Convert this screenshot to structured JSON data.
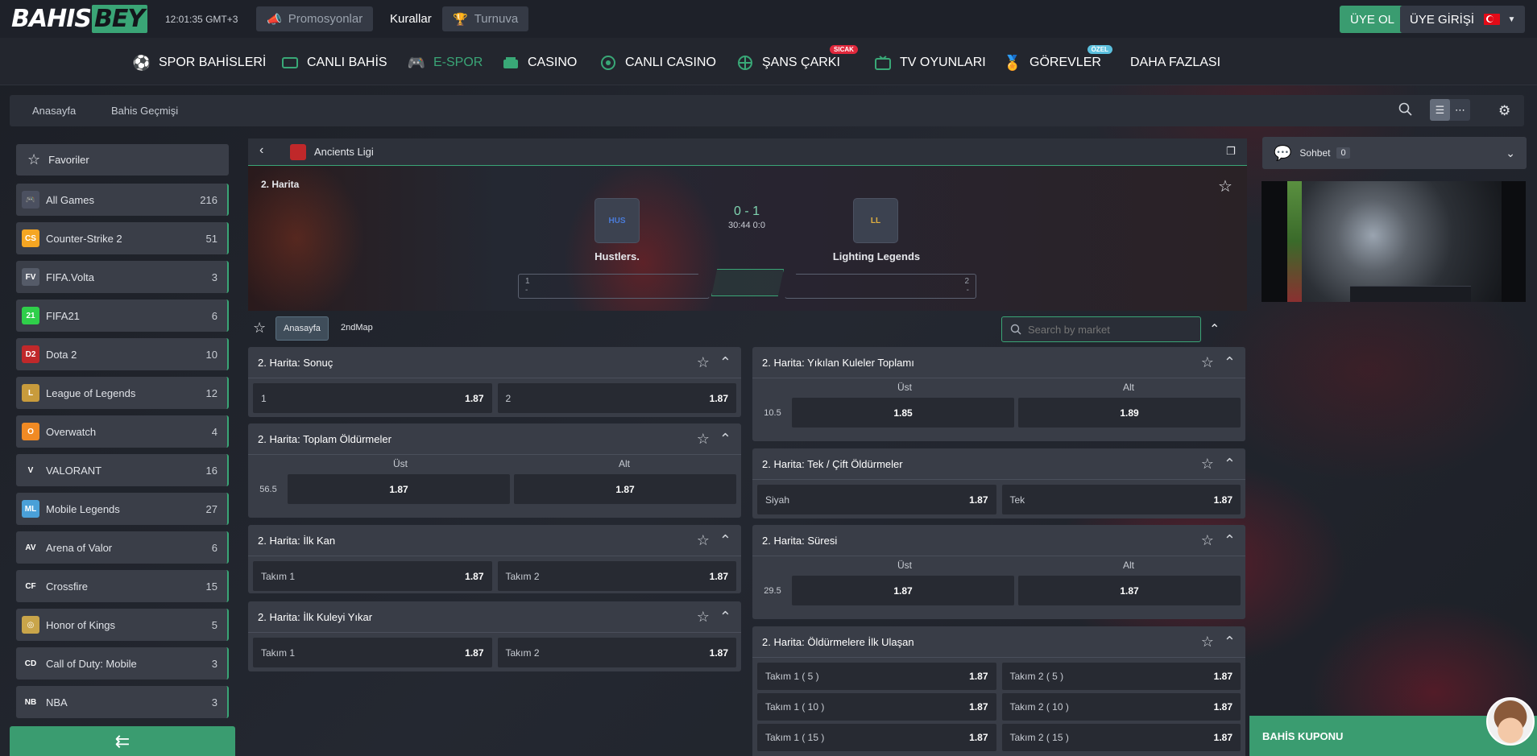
{
  "header": {
    "logo_a": "BAHIS",
    "logo_b": "BEY",
    "clock": "12:01:35",
    "tz": "GMT+3",
    "promo": "Promosyonlar",
    "rules": "Kurallar",
    "tournament": "Turnuva",
    "register": "ÜYE OL",
    "login": "ÜYE GİRİŞİ"
  },
  "nav": {
    "items": [
      {
        "label": "SPOR BAHİSLERİ",
        "icon": "soccer-ball-icon"
      },
      {
        "label": "CANLI BAHİS",
        "icon": "live-icon"
      },
      {
        "label": "E-SPOR",
        "icon": "gamepad-icon"
      },
      {
        "label": "CASINO",
        "icon": "slot-icon"
      },
      {
        "label": "CANLI CASINO",
        "icon": "roulette-icon"
      },
      {
        "label": "ŞANS ÇARKI",
        "icon": "wheel-icon",
        "badge": "SICAK"
      },
      {
        "label": "TV OYUNLARI",
        "icon": "tv-icon"
      },
      {
        "label": "GÖREVLER",
        "icon": "trophy-icon",
        "badge": "ÖZEL"
      },
      {
        "label": "DAHA FAZLASI"
      }
    ],
    "colors": {
      "accent": "#3aa576",
      "hot": "#e0283c",
      "special": "#5bc0de"
    }
  },
  "crumbs": {
    "home": "Anasayfa",
    "history": "Bahis Geçmişi"
  },
  "sidebar": {
    "favorites": "Favoriler",
    "items": [
      {
        "label": "All Games",
        "count": "216",
        "color": "#4b5060",
        "abbr": "🎮"
      },
      {
        "label": "Counter-Strike 2",
        "count": "51",
        "color": "#f5a623",
        "abbr": "CS"
      },
      {
        "label": "FIFA.Volta",
        "count": "3",
        "color": "#555b68",
        "abbr": "FV"
      },
      {
        "label": "FIFA21",
        "count": "6",
        "color": "#2fcf4a",
        "abbr": "21"
      },
      {
        "label": "Dota 2",
        "count": "10",
        "color": "#c0282a",
        "abbr": "D2"
      },
      {
        "label": "League of Legends",
        "count": "12",
        "color": "#c89b3c",
        "abbr": "L"
      },
      {
        "label": "Overwatch",
        "count": "4",
        "color": "#f08a24",
        "abbr": "O"
      },
      {
        "label": "VALORANT",
        "count": "16",
        "color": "#3a3e48",
        "abbr": "V"
      },
      {
        "label": "Mobile Legends",
        "count": "27",
        "color": "#4aa0d8",
        "abbr": "ML"
      },
      {
        "label": "Arena of Valor",
        "count": "6",
        "color": "#3a3e48",
        "abbr": "AV"
      },
      {
        "label": "Crossfire",
        "count": "15",
        "color": "#3a3e48",
        "abbr": "CF"
      },
      {
        "label": "Honor of Kings",
        "count": "5",
        "color": "#c9a54a",
        "abbr": "◎"
      },
      {
        "label": "Call of Duty: Mobile",
        "count": "3",
        "color": "#3a3e48",
        "abbr": "CD"
      },
      {
        "label": "NBA",
        "count": "3",
        "color": "#3a3e48",
        "abbr": "NB"
      }
    ]
  },
  "match": {
    "league": "Ancients Ligi",
    "map": "2. Harita",
    "score": "0 - 1",
    "time": "30:44",
    "sub": "0:0",
    "team1": "Hustlers.",
    "team2": "Lighting Legends",
    "pill1_top": "1",
    "pill1_bot": "-",
    "pill2_top": "2",
    "pill2_bot": "-"
  },
  "tabs": {
    "home": "Anasayfa",
    "map": "2ndMap",
    "search_placeholder": "Search by market"
  },
  "markets": {
    "m1": {
      "title": "2. Harita: Sonuç",
      "a": "1",
      "ao": "1.87",
      "b": "2",
      "bo": "1.87"
    },
    "m2": {
      "title": "2. Harita: Toplam Öldürmeler",
      "col1": "Üst",
      "col2": "Alt",
      "line": "56.5",
      "o1": "1.87",
      "o2": "1.87"
    },
    "m3": {
      "title": "2. Harita: İlk Kan",
      "a": "Takım 1",
      "ao": "1.87",
      "b": "Takım 2",
      "bo": "1.87"
    },
    "m4": {
      "title": "2. Harita: İlk Kuleyi Yıkar",
      "a": "Takım 1",
      "ao": "1.87",
      "b": "Takım 2",
      "bo": "1.87"
    },
    "m5": {
      "title": "2. Harita: Yıkılan Kuleler Toplamı",
      "col1": "Üst",
      "col2": "Alt",
      "line": "10.5",
      "o1": "1.85",
      "o2": "1.89"
    },
    "m6": {
      "title": "2. Harita: Tek / Çift Öldürmeler",
      "a": "Siyah",
      "ao": "1.87",
      "b": "Tek",
      "bo": "1.87"
    },
    "m7": {
      "title": "2. Harita: Süresi",
      "col1": "Üst",
      "col2": "Alt",
      "line": "29.5",
      "o1": "1.87",
      "o2": "1.87"
    },
    "m8": {
      "title": "2. Harita: Öldürmelere İlk Ulaşan",
      "rows": [
        {
          "a": "Takım 1 ( 5 )",
          "ao": "1.87",
          "b": "Takım 2 ( 5 )",
          "bo": "1.87"
        },
        {
          "a": "Takım 1 ( 10 )",
          "ao": "1.87",
          "b": "Takım 2 ( 10 )",
          "bo": "1.87"
        },
        {
          "a": "Takım 1 ( 15 )",
          "ao": "1.87",
          "b": "Takım 2 ( 15 )",
          "bo": "1.87"
        }
      ]
    }
  },
  "chat": {
    "label": "Sohbet",
    "count": "0"
  },
  "coupon": {
    "label": "BAHİS KUPONU"
  }
}
